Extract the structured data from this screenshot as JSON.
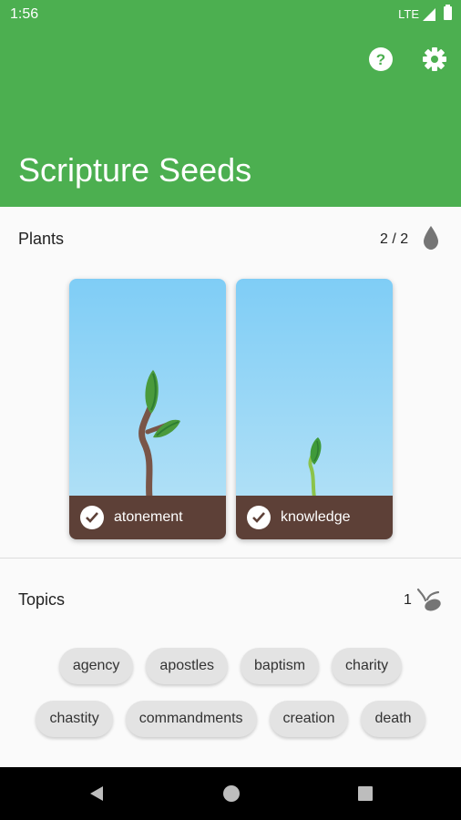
{
  "status_bar": {
    "time": "1:56",
    "network": "LTE"
  },
  "app_bar": {
    "title": "Scripture Seeds"
  },
  "plants": {
    "label": "Plants",
    "count": "2 / 2",
    "cards": [
      {
        "name": "atonement"
      },
      {
        "name": "knowledge"
      }
    ]
  },
  "topics": {
    "label": "Topics",
    "count": "1",
    "chips": [
      [
        "agency",
        "apostles",
        "baptism",
        "charity"
      ],
      [
        "chastity",
        "commandments",
        "creation",
        "death"
      ]
    ]
  },
  "colors": {
    "accent": "#4caf50",
    "soil": "#5d4037"
  }
}
